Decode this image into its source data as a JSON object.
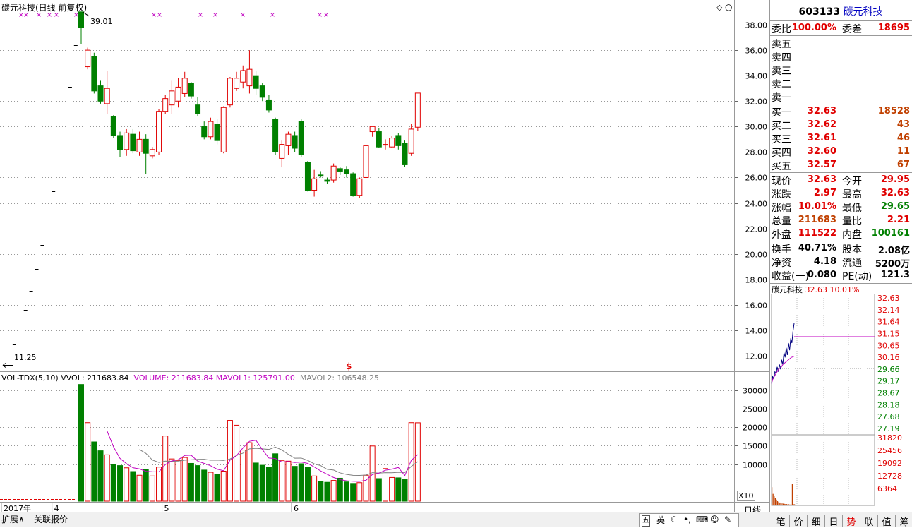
{
  "main_chart": {
    "title": "碳元科技(日线 前复权)",
    "high_label": "39.01",
    "low_label": "11.25",
    "y_axis": {
      "min": 11.0,
      "max": 39.5,
      "ticks": [
        38,
        36,
        34,
        32,
        30,
        28,
        26,
        24,
        22,
        20,
        18,
        16,
        14,
        12
      ]
    },
    "candles": [
      {
        "o": 39.01,
        "h": 39.01,
        "l": 36.5,
        "c": 37.8
      },
      {
        "o": 34.7,
        "h": 36.2,
        "l": 34.5,
        "c": 36.0
      },
      {
        "o": 35.5,
        "h": 35.8,
        "l": 32.6,
        "c": 32.8
      },
      {
        "o": 33.2,
        "h": 33.6,
        "l": 31.8,
        "c": 32.0
      },
      {
        "o": 31.8,
        "h": 34.4,
        "l": 31.0,
        "c": 33.0
      },
      {
        "o": 30.8,
        "h": 30.9,
        "l": 29.1,
        "c": 29.3
      },
      {
        "o": 29.3,
        "h": 29.6,
        "l": 27.6,
        "c": 28.2
      },
      {
        "o": 28.2,
        "h": 29.8,
        "l": 27.7,
        "c": 29.5
      },
      {
        "o": 29.4,
        "h": 29.8,
        "l": 27.9,
        "c": 28.1
      },
      {
        "o": 28.0,
        "h": 29.6,
        "l": 27.7,
        "c": 29.0
      },
      {
        "o": 29.0,
        "h": 29.4,
        "l": 26.3,
        "c": 27.9
      },
      {
        "o": 27.7,
        "h": 28.4,
        "l": 27.5,
        "c": 28.2
      },
      {
        "o": 28.0,
        "h": 31.4,
        "l": 27.8,
        "c": 31.2
      },
      {
        "o": 31.2,
        "h": 32.5,
        "l": 31.0,
        "c": 32.2
      },
      {
        "o": 31.7,
        "h": 33.6,
        "l": 31.0,
        "c": 32.8
      },
      {
        "o": 32.0,
        "h": 33.8,
        "l": 31.5,
        "c": 33.1
      },
      {
        "o": 32.6,
        "h": 34.3,
        "l": 32.3,
        "c": 33.8
      },
      {
        "o": 33.4,
        "h": 33.5,
        "l": 32.2,
        "c": 32.4
      },
      {
        "o": 31.7,
        "h": 32.3,
        "l": 30.8,
        "c": 31.0
      },
      {
        "o": 30.0,
        "h": 30.4,
        "l": 29.0,
        "c": 29.2
      },
      {
        "o": 29.2,
        "h": 30.7,
        "l": 29.0,
        "c": 30.4
      },
      {
        "o": 30.2,
        "h": 30.6,
        "l": 28.6,
        "c": 28.9
      },
      {
        "o": 28.0,
        "h": 31.6,
        "l": 27.9,
        "c": 31.5
      },
      {
        "o": 31.7,
        "h": 33.9,
        "l": 31.5,
        "c": 33.8
      },
      {
        "o": 33.0,
        "h": 34.3,
        "l": 32.8,
        "c": 33.8
      },
      {
        "o": 33.5,
        "h": 34.8,
        "l": 33.0,
        "c": 34.4
      },
      {
        "o": 33.2,
        "h": 36.0,
        "l": 32.6,
        "c": 34.5
      },
      {
        "o": 34.0,
        "h": 34.4,
        "l": 32.5,
        "c": 33.0
      },
      {
        "o": 33.2,
        "h": 33.4,
        "l": 32.0,
        "c": 32.3
      },
      {
        "o": 32.1,
        "h": 32.5,
        "l": 31.1,
        "c": 31.3
      },
      {
        "o": 30.6,
        "h": 30.7,
        "l": 27.8,
        "c": 28.0
      },
      {
        "o": 27.5,
        "h": 28.9,
        "l": 26.8,
        "c": 28.6
      },
      {
        "o": 28.5,
        "h": 29.6,
        "l": 27.8,
        "c": 29.4
      },
      {
        "o": 29.3,
        "h": 29.6,
        "l": 28.0,
        "c": 28.3
      },
      {
        "o": 30.4,
        "h": 30.6,
        "l": 27.6,
        "c": 27.8
      },
      {
        "o": 27.2,
        "h": 27.3,
        "l": 24.9,
        "c": 25.0
      },
      {
        "o": 25.0,
        "h": 26.6,
        "l": 24.5,
        "c": 25.9
      },
      {
        "o": 26.2,
        "h": 26.5,
        "l": 26.0,
        "c": 26.1
      },
      {
        "o": 25.8,
        "h": 26.0,
        "l": 25.5,
        "c": 25.7
      },
      {
        "o": 25.8,
        "h": 27.1,
        "l": 25.6,
        "c": 26.9
      },
      {
        "o": 26.7,
        "h": 26.8,
        "l": 26.2,
        "c": 26.5
      },
      {
        "o": 26.6,
        "h": 26.9,
        "l": 26.0,
        "c": 26.3
      },
      {
        "o": 26.3,
        "h": 26.4,
        "l": 24.5,
        "c": 24.6
      },
      {
        "o": 24.6,
        "h": 26.0,
        "l": 24.4,
        "c": 25.9
      },
      {
        "o": 26.0,
        "h": 28.6,
        "l": 25.9,
        "c": 28.5
      },
      {
        "o": 29.6,
        "h": 30.0,
        "l": 29.2,
        "c": 30.0
      },
      {
        "o": 29.6,
        "h": 29.9,
        "l": 28.3,
        "c": 28.4
      },
      {
        "o": 28.6,
        "h": 29.0,
        "l": 28.2,
        "c": 28.6
      },
      {
        "o": 28.4,
        "h": 29.3,
        "l": 28.3,
        "c": 29.1
      },
      {
        "o": 29.3,
        "h": 29.5,
        "l": 28.2,
        "c": 28.5
      },
      {
        "o": 28.7,
        "h": 28.9,
        "l": 26.8,
        "c": 27.0
      },
      {
        "o": 27.9,
        "h": 30.2,
        "l": 27.7,
        "c": 29.8
      },
      {
        "o": 29.95,
        "h": 32.63,
        "l": 29.65,
        "c": 32.63
      }
    ],
    "pre_ipo_steps": [
      11.6,
      12.9,
      14.2,
      15.6,
      17.1,
      18.8,
      20.7,
      22.7,
      24.9,
      27.4,
      30.1,
      33.1,
      36.4
    ],
    "x_labels": [
      {
        "label": "2017年",
        "i": -14
      },
      {
        "label": "4",
        "i": -2
      },
      {
        "label": "5",
        "i": 15
      },
      {
        "label": "6",
        "i": 35
      }
    ]
  },
  "volume_chart": {
    "legend": {
      "name": "VOL-TDX(5,10)",
      "vvol": "VVOL: 211683.84",
      "volume": "VOLUME: 211683.84",
      "mavol1": "MAVOL1: 125791.00",
      "mavol2": "MAVOL2: 106548.25"
    },
    "y_axis": {
      "min": 0,
      "max": 31820,
      "ticks": [
        30000,
        25000,
        20000,
        15000,
        10000
      ]
    },
    "unit_label": "X10",
    "values": [
      31500,
      21200,
      16000,
      13600,
      12500,
      10000,
      9600,
      9000,
      8000,
      7000,
      8500,
      6800,
      9200,
      17600,
      11400,
      11000,
      11800,
      10200,
      9600,
      8400,
      7800,
      7200,
      8100,
      21800,
      20500,
      13800,
      15800,
      10300,
      9700,
      9200,
      12800,
      11000,
      10800,
      9400,
      10100,
      9100,
      6800,
      5400,
      5100,
      5600,
      6200,
      5200,
      4800,
      5000,
      7000,
      14900,
      6100,
      8800,
      6400,
      6300,
      6000,
      21200,
      21168
    ],
    "mavol1": [
      null,
      null,
      null,
      null,
      18960,
      14660,
      11540,
      10140,
      9020,
      8720,
      8060,
      7960,
      7900,
      9880,
      10860,
      11200,
      12340,
      12400,
      10800,
      10200,
      9560,
      8640,
      8220,
      11060,
      12280,
      14400,
      16160,
      16440,
      13900,
      11640,
      11500,
      10580,
      10700,
      10440,
      10540,
      10200,
      9240,
      8160,
      7260,
      6400,
      5820,
      5500,
      5380,
      5360,
      5640,
      7220,
      7580,
      8360,
      8640,
      9100,
      6920,
      11020,
      12579
    ],
    "mavol2": [
      null,
      null,
      null,
      null,
      null,
      null,
      null,
      null,
      null,
      13940,
      12900,
      11100,
      10450,
      10820,
      10740,
      10820,
      11060,
      11180,
      11300,
      11310,
      11040,
      11080,
      10970,
      11390,
      12330,
      12960,
      14120,
      14270,
      14120,
      13970,
      14590,
      13830,
      12640,
      11590,
      11630,
      11000,
      10090,
      9600,
      8590,
      8400,
      7630,
      7210,
      6990,
      6950,
      7060,
      7700,
      7580,
      7690,
      7670,
      7780,
      7750,
      9380,
      10655
    ]
  },
  "x_axis": {
    "year_label": "2017年",
    "month_labels": [
      "4",
      "5",
      "6"
    ]
  },
  "panel": {
    "code": "603133",
    "name": "碳元科技",
    "weibi_label": "委比",
    "weibi": "100.00%",
    "weicha_label": "委差",
    "weicha": "18695",
    "sell": [
      {
        "label": "卖五"
      },
      {
        "label": "卖四"
      },
      {
        "label": "卖三"
      },
      {
        "label": "卖二"
      },
      {
        "label": "卖一"
      }
    ],
    "buy": [
      {
        "label": "买一",
        "price": "32.63",
        "vol": "18528"
      },
      {
        "label": "买二",
        "price": "32.62",
        "vol": "43"
      },
      {
        "label": "买三",
        "price": "32.61",
        "vol": "46"
      },
      {
        "label": "买四",
        "price": "32.60",
        "vol": "11"
      },
      {
        "label": "买五",
        "price": "32.57",
        "vol": "67"
      }
    ],
    "quote": [
      {
        "l1": "现价",
        "v1": "32.63",
        "l2": "今开",
        "v2": "29.95"
      },
      {
        "l1": "涨跌",
        "v1": "2.97",
        "l2": "最高",
        "v2": "32.63"
      },
      {
        "l1": "涨幅",
        "v1": "10.01%",
        "l2": "最低",
        "v2": "29.65"
      },
      {
        "l1": "总量",
        "v1": "211683",
        "l2": "量比",
        "v2": "2.21"
      },
      {
        "l1": "外盘",
        "v1": "111522",
        "l2": "内盘",
        "v2": "100161"
      }
    ],
    "fund": [
      {
        "l1": "换手",
        "v1": "40.71%",
        "l2": "股本",
        "v2": "2.08亿"
      },
      {
        "l1": "净资",
        "v1": "4.18",
        "l2": "流通",
        "v2": "5200万"
      },
      {
        "l1": "收益(一)",
        "v1": "0.080",
        "l2": "PE(动)",
        "v2": "121.3"
      }
    ]
  },
  "mini_chart": {
    "title": "碳元科技",
    "price": "32.63",
    "pct": "10.01%",
    "price_ticks": [
      "32.63",
      "32.14",
      "31.64",
      "31.15",
      "30.65",
      "30.16",
      "29.66",
      "29.17",
      "28.67",
      "28.18",
      "27.68",
      "27.19"
    ],
    "vol_ticks": [
      "31820",
      "25456",
      "19092",
      "12728",
      "6364"
    ],
    "price_line": [
      30.1,
      30.4,
      30.3,
      30.6,
      30.5,
      30.8,
      30.6,
      30.9,
      30.7,
      31.1,
      30.9,
      31.4,
      31.2,
      31.6,
      31.3,
      31.8,
      31.5,
      32.0,
      31.8,
      32.3,
      32.63
    ],
    "avg_line": [
      30.1,
      30.3,
      30.4,
      30.5,
      30.6,
      30.7,
      30.75,
      30.8,
      30.9,
      30.95,
      31.0,
      31.05,
      31.1,
      31.15,
      31.2,
      31.22,
      31.25
    ],
    "vol_bars": [
      8200,
      5200,
      4100,
      3300,
      2600,
      1900,
      1500,
      1300,
      1100,
      900,
      800,
      700,
      600,
      600,
      500,
      500,
      400,
      400,
      9800,
      600,
      500
    ]
  },
  "status": {
    "left_tabs": [
      "扩展∧",
      "关联报价"
    ],
    "ime": [
      "五",
      "英"
    ],
    "right_tabs": [
      "笔",
      "价",
      "细",
      "日",
      "势",
      "联",
      "值",
      "筹"
    ],
    "period": "日线"
  }
}
